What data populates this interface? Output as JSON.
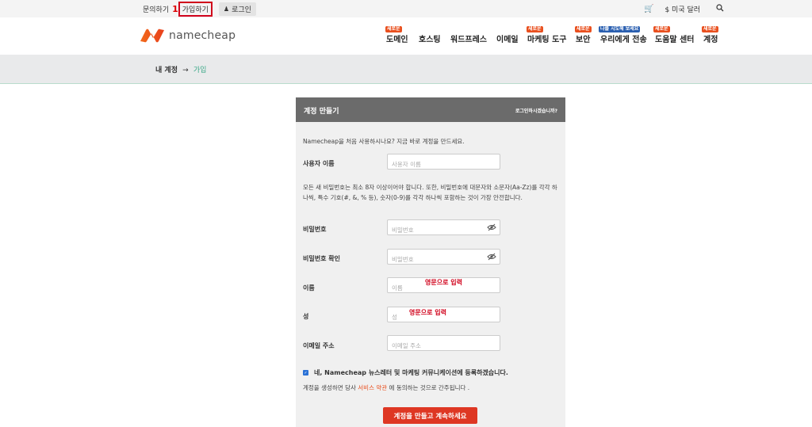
{
  "topbar": {
    "contact": "문의하기",
    "annotation": "1",
    "signup": "가입하기",
    "login": "로그인",
    "currency": "$ 미국 달러"
  },
  "header": {
    "logo_text": "namecheap",
    "nav": [
      {
        "label": "도메인",
        "badge": "새로운"
      },
      {
        "label": "호스팅"
      },
      {
        "label": "워드프레스"
      },
      {
        "label": "이메일"
      },
      {
        "label": "마케팅 도구",
        "badge": "새로운"
      },
      {
        "label": "보안",
        "badge": "새로운"
      },
      {
        "label": "우리에게 전송",
        "badge": "나를 시도해 보세요"
      },
      {
        "label": "도움말 센터",
        "badge": "새로운"
      },
      {
        "label": "계정",
        "badge": "새로운"
      }
    ]
  },
  "breadcrumb": {
    "parent": "내 계정",
    "arrow": "→",
    "current": "가입"
  },
  "form": {
    "title": "계정 만들기",
    "login_link": "로그인하시겠습니까?",
    "intro": "Namecheap을 처음 사용하시나요? 지금 바로 계정을 만드세요.",
    "username_label": "사용자 이름",
    "username_placeholder": "사용자 이름",
    "password_note": "모든 새 비밀번호는 최소 8자 이상이어야 합니다. 또한, 비밀번호에 대문자와 소문자(Aa-Zz)를 각각 하나씩, 특수 기호(#, &, % 등), 숫자(0-9)를 각각 하나씩 포함하는 것이 가장 안전합니다.",
    "password_label": "비밀번호",
    "password_placeholder": "비밀번호",
    "confirm_label": "비밀번호 확인",
    "confirm_placeholder": "비밀번호",
    "firstname_label": "이름",
    "firstname_placeholder": "이름",
    "firstname_hint": "영문으로 입력",
    "lastname_label": "성",
    "lastname_placeholder": "성",
    "lastname_hint": "영문으로 입력",
    "email_label": "이메일 주소",
    "email_placeholder": "이메일 주소",
    "newsletter": "네, Namecheap 뉴스레터 및 마케팅 커뮤니케이션에 등록하겠습니다.",
    "newsletter_checked": true,
    "terms_pre": "계정을 생성하면 당사",
    "terms_link": "서비스 약관",
    "terms_post": "에 동의하는 것으로 간주됩니다 .",
    "submit": "계정을 만들고 계속하세요"
  },
  "colors": {
    "brand_orange": "#e9501f",
    "submit_red": "#de3723",
    "annotation_red": "#d0021b",
    "breadcrumb_green": "#3aa887"
  }
}
